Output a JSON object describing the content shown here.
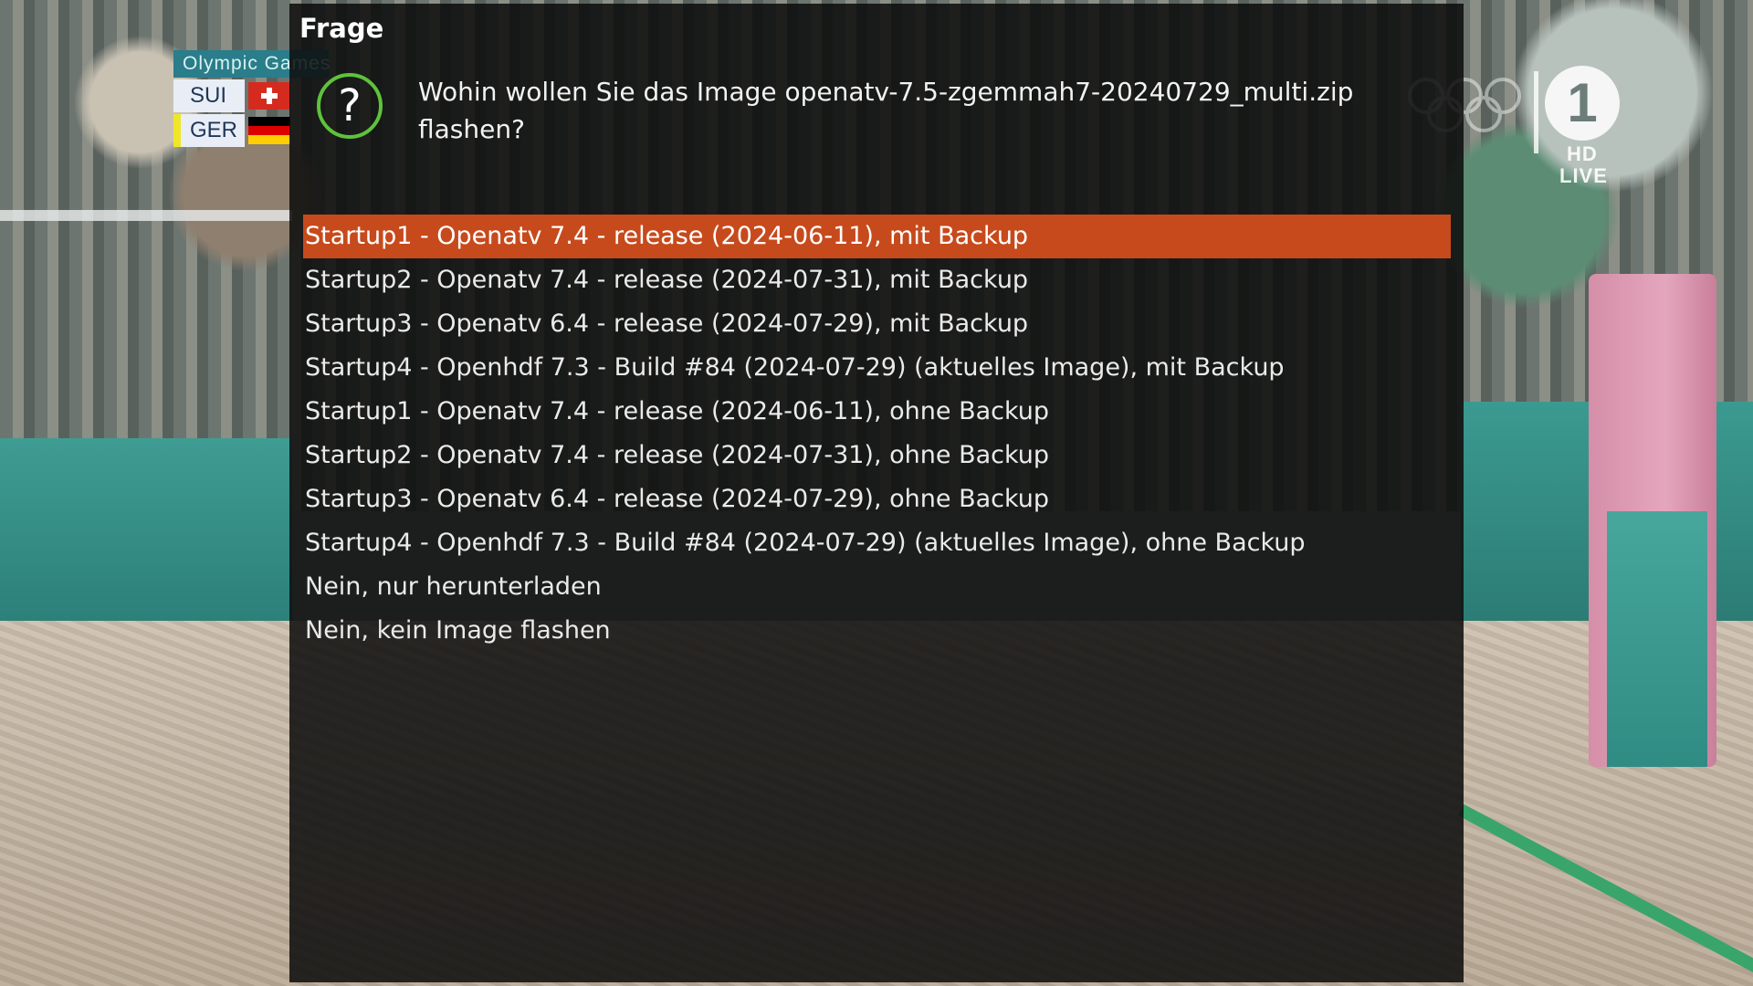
{
  "scoreboard": {
    "competition": "Olympic Games",
    "teams": [
      {
        "code": "SUI",
        "flag_icon": "swiss-flag-icon",
        "accent": "#e9eef6"
      },
      {
        "code": "GER",
        "flag_icon": "german-flag-icon",
        "accent": "#f0e628"
      }
    ]
  },
  "broadcaster": {
    "logo_text": "1",
    "hd": "HD",
    "live": "LIVE"
  },
  "dialog": {
    "title": "Frage",
    "icon": "question-icon",
    "question": "Wohin wollen Sie das Image openatv-7.5-zgemmah7-20240729_multi.zip flashen?",
    "selected_index": 0,
    "colors": {
      "selection": "#c74a1c",
      "icon_ring": "#5fc23a",
      "panel": "#0c0c0c"
    },
    "options": [
      "Startup1 - Openatv 7.4 - release (2024-06-11), mit Backup",
      "Startup2 - Openatv 7.4 - release (2024-07-31), mit Backup",
      "Startup3 - Openatv 6.4 - release (2024-07-29), mit Backup",
      "Startup4 - Openhdf 7.3 - Build #84 (2024-07-29) (aktuelles Image), mit Backup",
      "Startup1 - Openatv 7.4 - release (2024-06-11), ohne Backup",
      "Startup2 - Openatv 7.4 - release (2024-07-31), ohne Backup",
      "Startup3 - Openatv 6.4 - release (2024-07-29), ohne Backup",
      "Startup4 - Openhdf 7.3 - Build #84 (2024-07-29) (aktuelles Image), ohne Backup",
      "Nein, nur herunterladen",
      "Nein, kein Image flashen"
    ]
  }
}
